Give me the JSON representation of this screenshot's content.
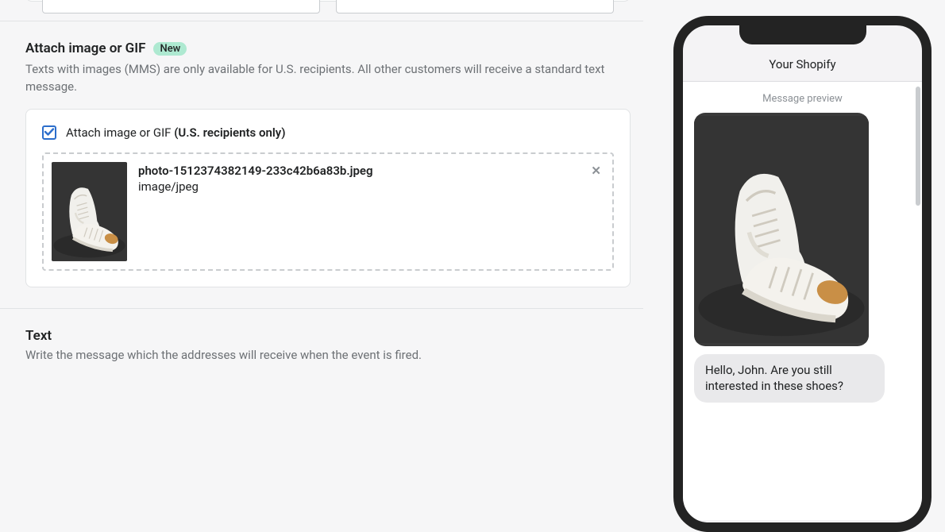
{
  "attach_section": {
    "title": "Attach image or GIF",
    "badge": "New",
    "description": "Texts with images (MMS) are only available for U.S. recipients. All other customers will receive a standard text message.",
    "checkbox_label_prefix": "Attach image or GIF ",
    "checkbox_label_bold": "(U.S. recipients only)",
    "file": {
      "name": "photo-1512374382149-233c42b6a83b.jpeg",
      "type": "image/jpeg"
    }
  },
  "text_section": {
    "title": "Text",
    "description": "Write the message which the addresses will receive when the event is fired."
  },
  "phone": {
    "header": "Your Shopify",
    "preview_label": "Message preview",
    "bubble_text": "Hello, John. Are you still interested in these shoes?"
  }
}
